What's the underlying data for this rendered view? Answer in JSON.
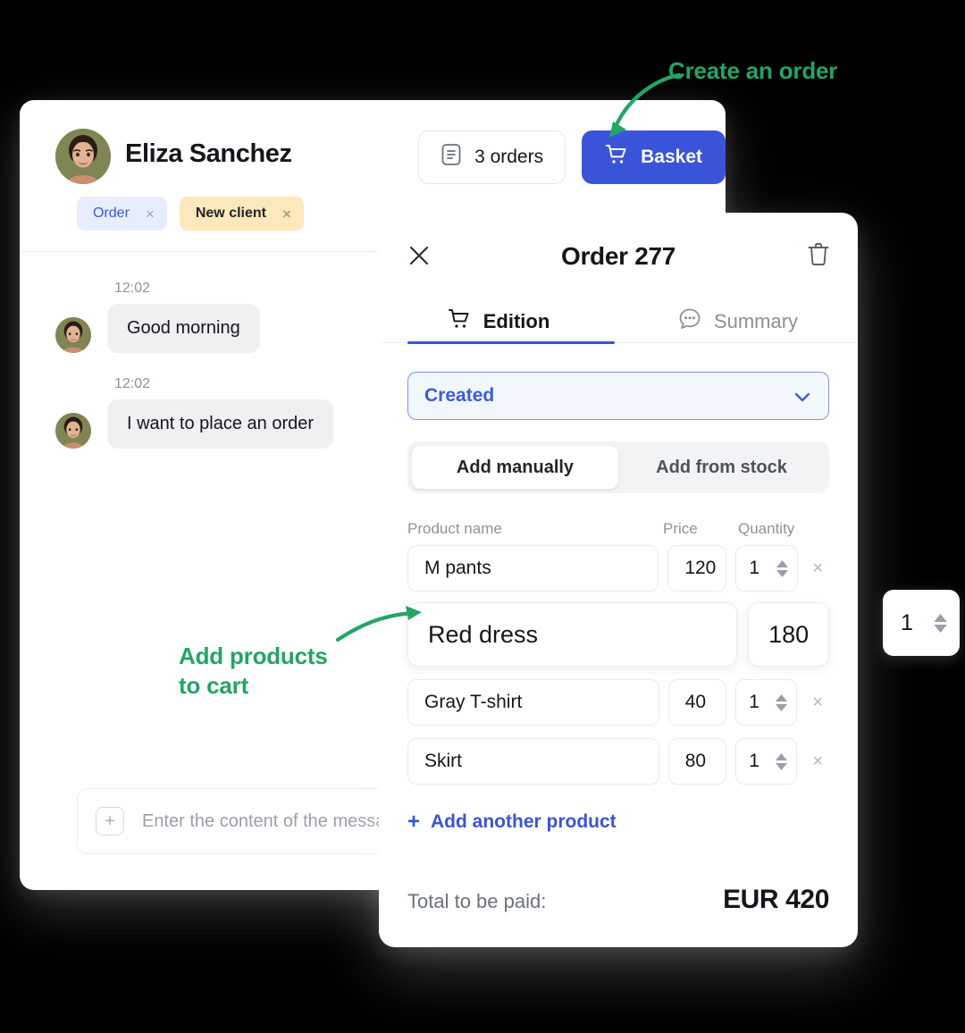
{
  "chat": {
    "client_name": "Eliza Sanchez",
    "avatar_name": "eliza-avatar",
    "tags": [
      {
        "label": "Order",
        "close": "×",
        "style": "blue"
      },
      {
        "label": "New client",
        "close": "×",
        "style": "amber"
      }
    ],
    "header_actions": {
      "orders_label": "3 orders",
      "basket_label": "Basket"
    },
    "messages": [
      {
        "time": "12:02",
        "text": "Good morning"
      },
      {
        "time": "12:02",
        "text": "I want to place an order"
      }
    ],
    "composer": {
      "plus": "+",
      "placeholder": "Enter the content of the message"
    }
  },
  "order_panel": {
    "title": "Order 277",
    "close_icon": "close-icon",
    "delete_icon": "trash-icon",
    "tabs": [
      {
        "label": "Edition",
        "icon": "cart-icon",
        "active": true
      },
      {
        "label": "Summary",
        "icon": "chat-bubble-icon",
        "active": false
      }
    ],
    "status": {
      "value": "Created",
      "chevron": "chevron-down-icon"
    },
    "source_toggle": [
      {
        "label": "Add manually",
        "active": true
      },
      {
        "label": "Add from stock",
        "active": false
      }
    ],
    "columns": {
      "name": "Product name",
      "price": "Price",
      "quantity": "Quantity"
    },
    "products": [
      {
        "name": "M pants",
        "price": "120",
        "qty": "1",
        "remove": "×"
      },
      {
        "name": "Red dress",
        "price": "180",
        "qty": "1",
        "remove": "×"
      },
      {
        "name": "Gray T-shirt",
        "price": "40",
        "qty": "1",
        "remove": "×"
      },
      {
        "name": "Skirt",
        "price": "80",
        "qty": "1",
        "remove": "×"
      }
    ],
    "floating_qty": "1",
    "add_product": {
      "plus": "+",
      "label": "Add another product"
    },
    "total": {
      "label": "Total to be paid:",
      "value": "EUR 420"
    }
  },
  "annotations": [
    {
      "name": "create-an-order",
      "text": "Create an order"
    },
    {
      "name": "add-products-to-cart",
      "line1": "Add products",
      "line2": "to cart"
    }
  ],
  "colors": {
    "accent_blue": "#3a54d9",
    "annotation_green": "#22a565",
    "tag_blue_bg": "#e7edfb",
    "tag_amber_bg": "#fce8bb",
    "page_bg": "#000000"
  }
}
